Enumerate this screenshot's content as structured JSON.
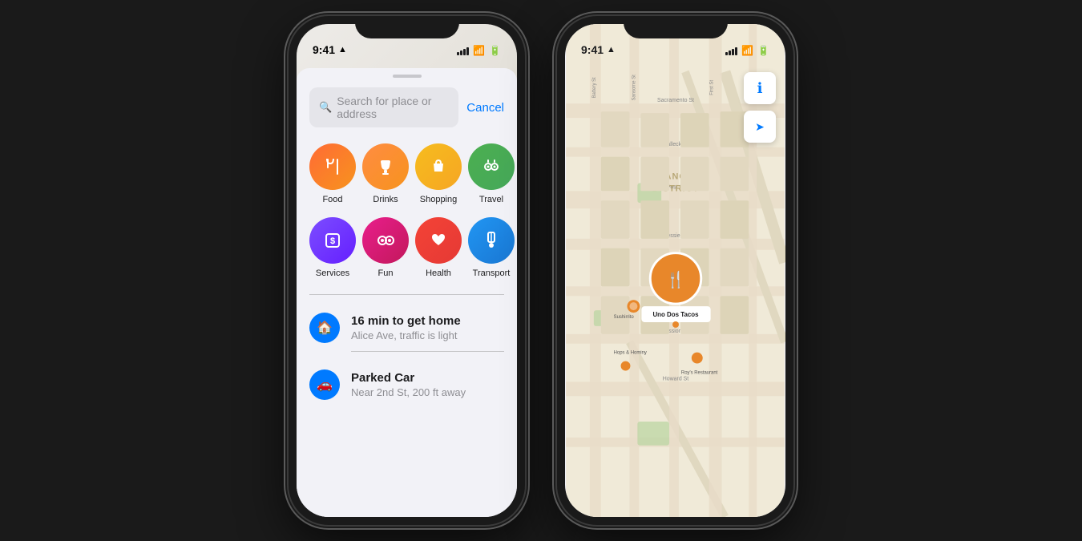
{
  "phone_left": {
    "status": {
      "time": "9:41",
      "location_arrow": "▲"
    },
    "search": {
      "placeholder": "Search for place or address",
      "cancel_label": "Cancel"
    },
    "categories": [
      {
        "id": "food",
        "label": "Food",
        "color_class": "cat-food",
        "icon": "🍴"
      },
      {
        "id": "drinks",
        "label": "Drinks",
        "color_class": "cat-drinks",
        "icon": "☕"
      },
      {
        "id": "shopping",
        "label": "Shopping",
        "color_class": "cat-shopping",
        "icon": "🛍"
      },
      {
        "id": "travel",
        "label": "Travel",
        "color_class": "cat-travel",
        "icon": "🔭"
      },
      {
        "id": "services",
        "label": "Services",
        "color_class": "cat-services",
        "icon": "💲"
      },
      {
        "id": "fun",
        "label": "Fun",
        "color_class": "cat-fun",
        "icon": "🎥"
      },
      {
        "id": "health",
        "label": "Health",
        "color_class": "cat-health",
        "icon": "❤"
      },
      {
        "id": "transport",
        "label": "Transport",
        "color_class": "cat-transport",
        "icon": "⛽"
      }
    ],
    "suggestions": [
      {
        "id": "home",
        "icon": "🏠",
        "icon_bg": "#007aff",
        "title": "16 min to get home",
        "subtitle": "Alice Ave, traffic is light"
      },
      {
        "id": "car",
        "icon": "🚗",
        "icon_bg": "#007aff",
        "title": "Parked Car",
        "subtitle": "Near 2nd St, 200 ft away"
      }
    ]
  },
  "phone_right": {
    "status": {
      "time": "9:41"
    },
    "map": {
      "pin_label": "Uno Dos Tacos",
      "info_icon": "ℹ",
      "location_icon": "➤"
    }
  }
}
